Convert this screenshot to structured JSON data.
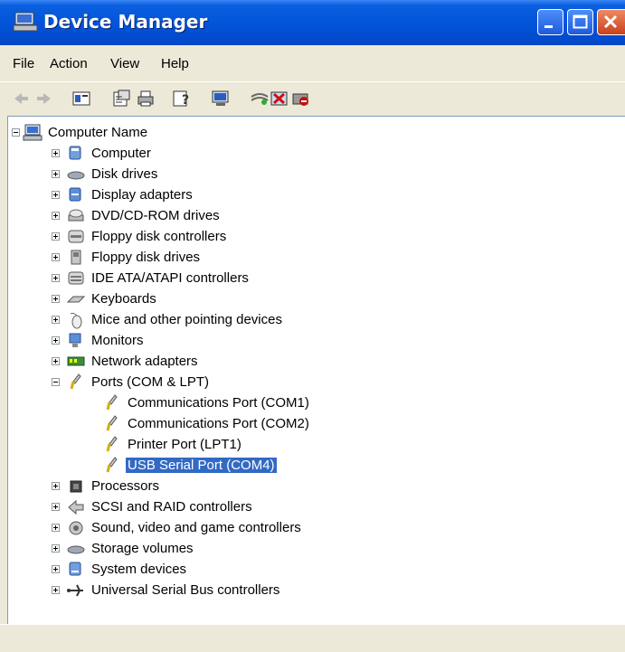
{
  "window": {
    "title": "Device Manager"
  },
  "menu": {
    "file": "File",
    "action": "Action",
    "view": "View",
    "help": "Help"
  },
  "toolbar": {
    "buttons": [
      "back-icon",
      "forward-icon",
      "properties-panel-icon",
      "properties-icon",
      "print-icon",
      "help-icon",
      "scan-hardware-icon",
      "update-driver-icon",
      "uninstall-icon",
      "disable-icon"
    ]
  },
  "tree": {
    "root": "Computer Name",
    "categories": [
      "Computer",
      "Disk drives",
      "Display adapters",
      "DVD/CD-ROM drives",
      "Floppy disk controllers",
      "Floppy disk drives",
      "IDE ATA/ATAPI controllers",
      "Keyboards",
      "Mice and other pointing devices",
      "Monitors",
      "Network adapters",
      "Ports (COM & LPT)",
      "Processors",
      "SCSI and RAID controllers",
      "Sound, video and game controllers",
      "Storage volumes",
      "System devices",
      "Universal Serial Bus controllers"
    ],
    "ports_children": [
      "Communications Port (COM1)",
      "Communications Port (COM2)",
      "Printer Port (LPT1)",
      "USB Serial Port (COM4)"
    ],
    "selected": "USB Serial Port (COM4)"
  },
  "colors": {
    "titlebar": "#0353d8",
    "selection": "#316ac5",
    "chrome": "#ece9d8"
  }
}
